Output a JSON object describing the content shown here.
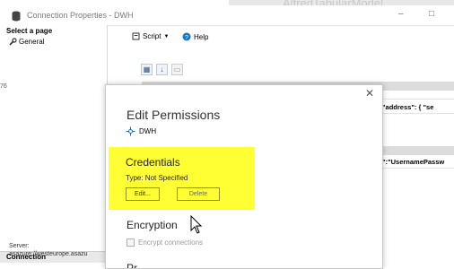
{
  "background_window": {
    "title": "AlfredTabularModel"
  },
  "window": {
    "title": "Connection Properties - DWH",
    "controls": {
      "minimize": "–",
      "maximize": "□"
    }
  },
  "sidebar": {
    "heading": "Select a page",
    "items": [
      {
        "label": "General"
      }
    ],
    "left_number": "76",
    "connection": {
      "heading": "Connection",
      "server_label": "Server:",
      "server_value": "asazure://westeurope.asazu"
    }
  },
  "toolbar": {
    "script_label": "Script",
    "help_label": "Help"
  },
  "properties": {
    "json_line1": "\"address\": {   \"se",
    "json_line2": "\":\"UsernamePassw"
  },
  "edit_permissions": {
    "title": "Edit Permissions",
    "datasource": "DWH",
    "credentials": {
      "heading": "Credentials",
      "type_text": "Type: Not Specified",
      "edit_label": "Edit...",
      "delete_label": "Delete"
    },
    "encryption": {
      "heading": "Encryption",
      "checkbox_label": "Encrypt connections"
    },
    "next_heading_cut": "Pr... ..."
  },
  "colors": {
    "highlight": "#ffff33",
    "accent": "#1e73be"
  }
}
